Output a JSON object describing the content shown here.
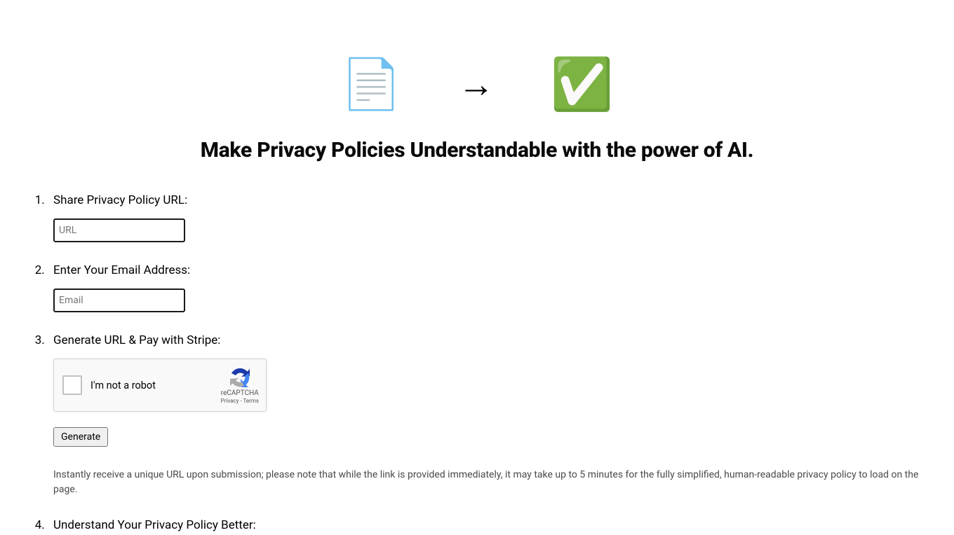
{
  "hero": {
    "doc_icon": "📄",
    "arrow_icon": "→",
    "check_icon": "✅"
  },
  "headline": "Make Privacy Policies Understandable with the power of AI.",
  "steps": {
    "step1": {
      "label": "Share Privacy Policy URL:",
      "placeholder": "URL"
    },
    "step2": {
      "label": "Enter Your Email Address:",
      "placeholder": "Email"
    },
    "step3": {
      "label": "Generate URL & Pay with Stripe:",
      "recaptcha_label": "I'm not a robot",
      "recaptcha_brand": "reCAPTCHA",
      "recaptcha_privacy": "Privacy",
      "recaptcha_terms": "Terms",
      "button_label": "Generate",
      "disclaimer": "Instantly receive a unique URL upon submission; please note that while the link is provided immediately, it may take up to 5 minutes for the fully simplified, human-readable privacy policy to load on the page."
    },
    "step4": {
      "label": "Understand Your Privacy Policy Better:"
    }
  }
}
